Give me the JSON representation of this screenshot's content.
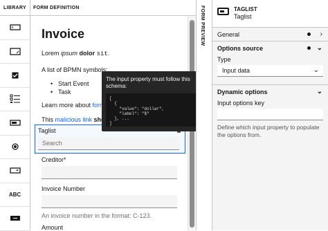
{
  "library": {
    "header": "LIBRARY",
    "abc_label": "ABC"
  },
  "form_definition": {
    "header": "FORM DEFINITION",
    "title": "Invoice",
    "lorem": {
      "plain": "Lorem ",
      "italic": "ipsum",
      "bold": "dolor",
      "mono": "sit",
      "end": "."
    },
    "list_intro": "A list of BPMN symbols:",
    "list_items": [
      "Start Event",
      "Task"
    ],
    "learn_more": {
      "text": "Learn more about ",
      "link": "forms"
    },
    "malicious": {
      "text": "This ",
      "link": "malicious link",
      "bold": " shou"
    },
    "taglist": {
      "label": "Taglist",
      "placeholder": "Search"
    },
    "creditor": {
      "label": "Creditor*"
    },
    "invoice_number": {
      "label": "Invoice Number",
      "hint": "An invoice number in the format: C-123."
    },
    "amount": {
      "label": "Amount"
    }
  },
  "tooltip": {
    "text": "The input property must follow this schema:",
    "code": "[\n  {\n    \"value\": \"dollar\",\n    \"label\": \"$\"\n  }, ...\n]"
  },
  "form_preview": {
    "label": "FORM PREVIEW"
  },
  "properties": {
    "title": "TAGLIST",
    "subtitle": "Taglist",
    "general": "General",
    "options_source": "Options source",
    "type_label": "Type",
    "type_value": "Input data",
    "dynamic_options": "Dynamic options",
    "input_key_label": "Input options key",
    "input_key_value": "",
    "help": "Define which input property to populate the options from."
  }
}
